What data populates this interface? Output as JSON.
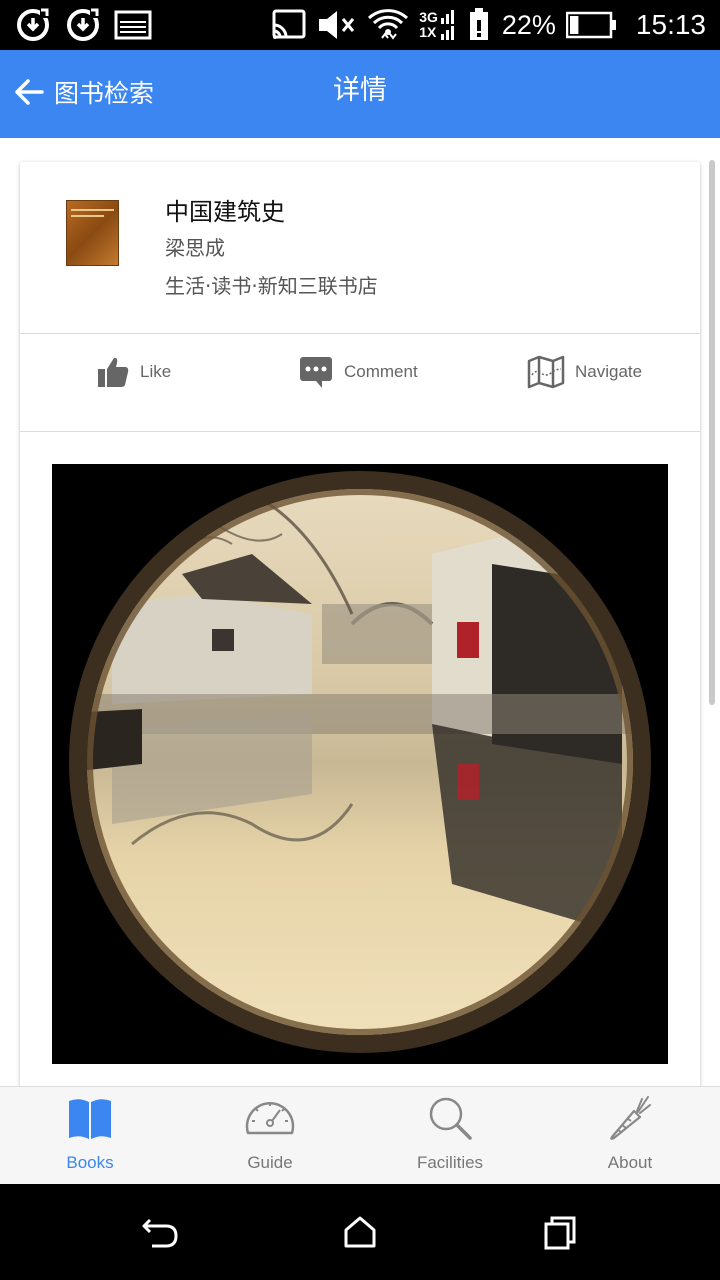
{
  "status_bar": {
    "icons_left": [
      "sync-icon",
      "sync-icon",
      "image-icon"
    ],
    "icons_right": [
      "cast-icon",
      "mute-icon",
      "wifi-icon",
      "cellular-icon",
      "battery-alert-icon"
    ],
    "network_top": "3G",
    "network_bottom": "1X",
    "battery_percent": "22%",
    "battery_level": 0.22,
    "time": "15:13"
  },
  "app_bar": {
    "back_label": "图书检索",
    "title": "详情",
    "color": "#3b86f0"
  },
  "book": {
    "title": "中国建筑史",
    "author": "梁思成",
    "publisher": "生活·读书·新知三联书店"
  },
  "actions": [
    {
      "icon": "thumbs-up-icon",
      "label": "Like"
    },
    {
      "icon": "comment-icon",
      "label": "Comment"
    },
    {
      "icon": "map-icon",
      "label": "Navigate"
    }
  ],
  "bottom_nav": {
    "active_color": "#3b86f0",
    "items": [
      {
        "icon": "book-icon",
        "label": "Books",
        "active": true
      },
      {
        "icon": "gauge-icon",
        "label": "Guide",
        "active": false
      },
      {
        "icon": "search-icon",
        "label": "Facilities",
        "active": false
      },
      {
        "icon": "carrot-icon",
        "label": "About",
        "active": false
      }
    ]
  },
  "system_nav": [
    "back-icon",
    "home-icon",
    "recents-icon"
  ]
}
